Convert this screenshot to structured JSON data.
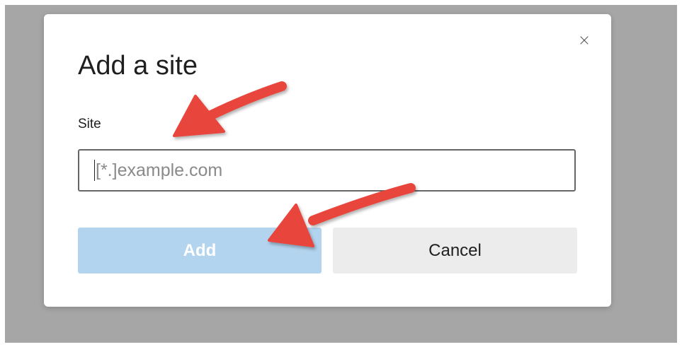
{
  "dialog": {
    "title": "Add a site",
    "close_icon": "×",
    "field_label": "Site",
    "input": {
      "value": "",
      "placeholder": "[*.]example.com"
    },
    "buttons": {
      "add_label": "Add",
      "cancel_label": "Cancel"
    }
  },
  "colors": {
    "backdrop": "#a6a6a6",
    "add_button_bg": "#b3d4ef",
    "cancel_button_bg": "#ececec",
    "annotation_arrow": "#e8453c"
  },
  "annotations": {
    "arrow_icon": "red-arrow",
    "count": 2
  }
}
